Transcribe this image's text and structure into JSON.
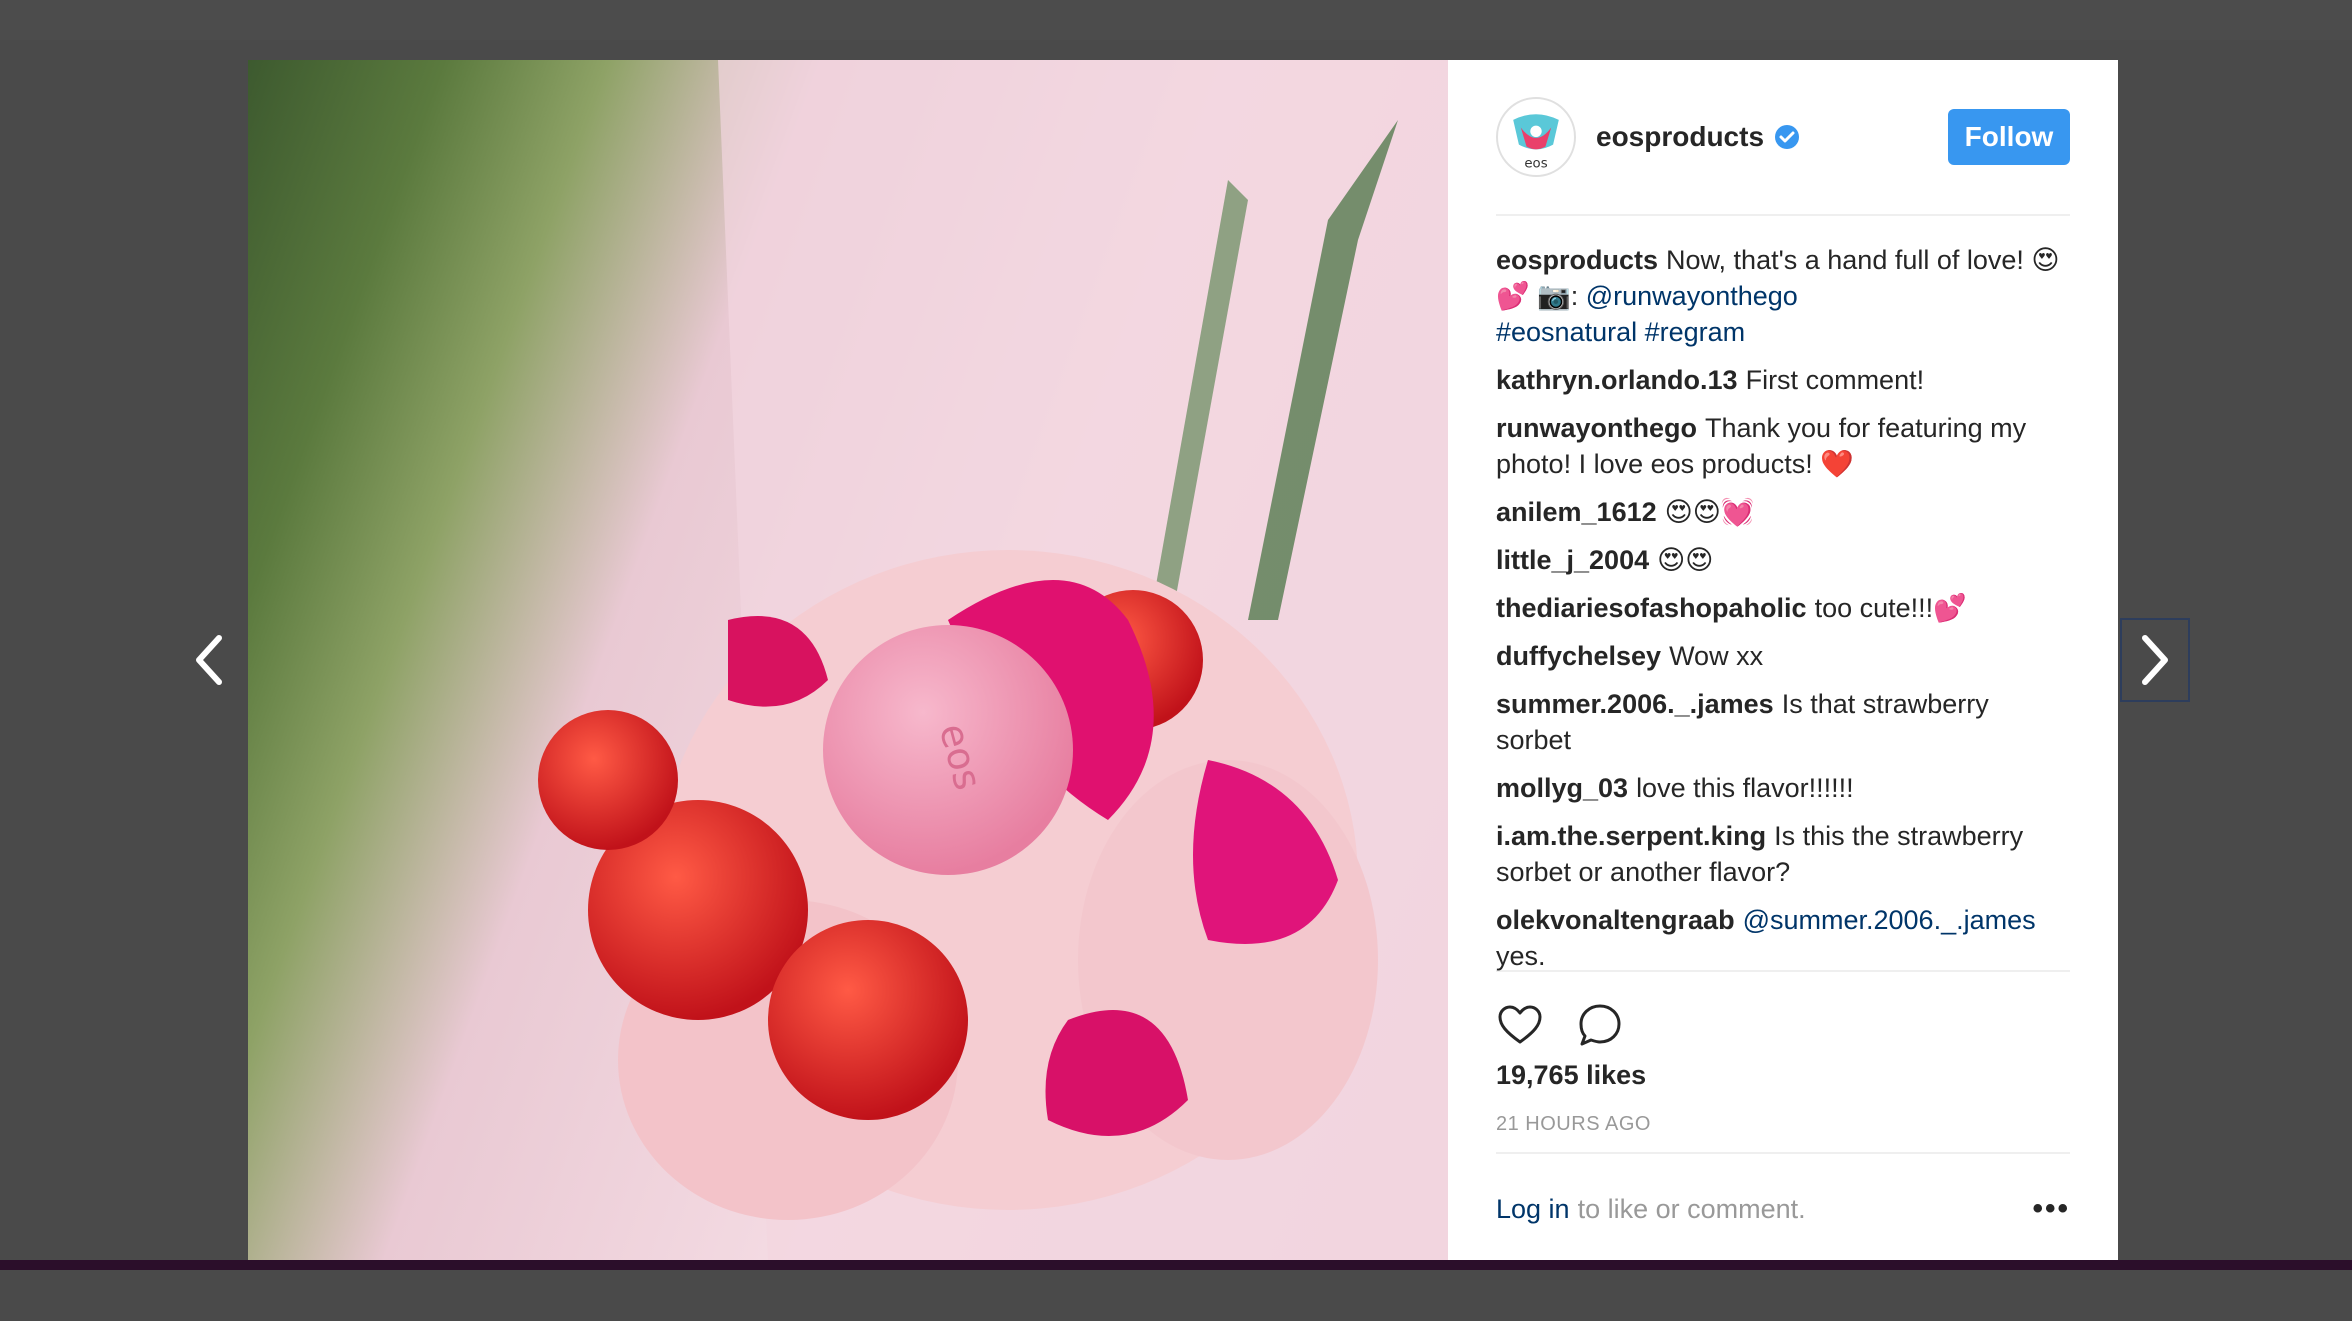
{
  "post": {
    "username": "eosproducts",
    "follow_label": "Follow",
    "avatar_text": "eos",
    "caption": {
      "user": "eosproducts",
      "text": "Now, that's a hand full of love! 😍💕 📷: ",
      "mention": "@runwayonthego",
      "hashtags": "#eosnatural #regram"
    },
    "comments": [
      {
        "user": "kathryn.orlando.13",
        "text": "First comment!"
      },
      {
        "user": "runwayonthego",
        "text": "Thank you for featuring my photo! I love eos products! ❤️"
      },
      {
        "user": "anilem_1612",
        "text": "😍😍💓"
      },
      {
        "user": "little_j_2004",
        "text": "😍😍"
      },
      {
        "user": "thediariesofashopaholic",
        "text": "too cute!!!💕"
      },
      {
        "user": "duffychelsey",
        "text": "Wow xx"
      },
      {
        "user": "summer.2006._.james",
        "text": "Is that strawberry sorbet"
      },
      {
        "user": "mollyg_03",
        "text": "love this flavor!!!!!!"
      },
      {
        "user": "i.am.the.serpent.king",
        "text": "Is this the strawberry sorbet or another flavor?"
      },
      {
        "user": "olekvonaltengraab",
        "mention": "@summer.2006._.james",
        "text": "yes."
      }
    ],
    "likes": "19,765 likes",
    "timestamp": "21 HOURS AGO",
    "login_link": "Log in",
    "login_text": "to like or comment.",
    "more_label": "•••"
  },
  "icons": {
    "prev": "chevron-left-icon",
    "next": "chevron-right-icon",
    "like": "heart-outline-icon",
    "comment": "speech-bubble-icon",
    "verified": "verified-badge-icon"
  },
  "colors": {
    "follow": "#3897f0",
    "link": "#003569",
    "backdrop": "#4a4a4a"
  }
}
